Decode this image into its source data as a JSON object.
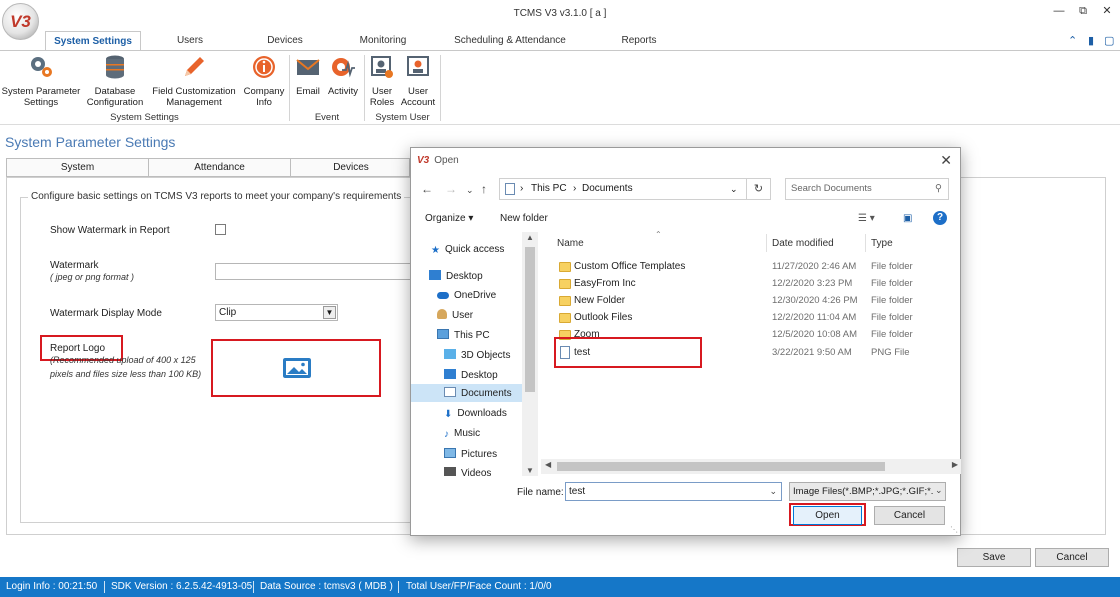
{
  "app": {
    "logo_text": "V3",
    "title": "TCMS V3 v3.1.0 [ a ]"
  },
  "ribbon": {
    "tabs": [
      {
        "label": "System Settings",
        "active": true
      },
      {
        "label": "Users"
      },
      {
        "label": "Devices"
      },
      {
        "label": "Monitoring"
      },
      {
        "label": "Scheduling & Attendance"
      },
      {
        "label": "Reports"
      }
    ],
    "buttons": [
      {
        "line1": "System Parameter",
        "line2": "Settings",
        "icon": "gears-icon"
      },
      {
        "line1": "Database",
        "line2": "Configuration",
        "icon": "database-icon"
      },
      {
        "line1": "Field Customization",
        "line2": "Management",
        "icon": "pencil-icon"
      },
      {
        "line1": "Company",
        "line2": "Info",
        "icon": "info-icon"
      },
      {
        "line1": "Email",
        "line2": "",
        "icon": "envelope-icon"
      },
      {
        "line1": "Activity",
        "line2": "",
        "icon": "activity-icon"
      },
      {
        "line1": "User",
        "line2": "Roles",
        "icon": "user-roles-icon"
      },
      {
        "line1": "User",
        "line2": "Account",
        "icon": "user-account-icon"
      }
    ],
    "groups": [
      "System Settings",
      "Event",
      "System User"
    ]
  },
  "page": {
    "title": "System Parameter Settings",
    "tabs": [
      "System",
      "Attendance",
      "Devices"
    ],
    "legend": "Configure basic settings on TCMS V3 reports to meet your company's requirements",
    "show_watermark_label": "Show Watermark in Report",
    "watermark_label": "Watermark",
    "watermark_hint": "( jpeg or png format )",
    "watermark_mode_label": "Watermark Display Mode",
    "watermark_mode_value": "Clip",
    "report_logo_label": "Report Logo",
    "report_logo_hint_1": "(Recommended upload of 400 x 125",
    "report_logo_hint_2": "pixels and files size less than 100 KB)",
    "save_label": "Save",
    "cancel_label": "Cancel"
  },
  "status": {
    "login": "Login Info : 00:21:50",
    "sdk": "SDK Version : 6.2.5.42-4913-05",
    "datasource": "Data Source : tcmsv3 ( MDB )",
    "count": "Total User/FP/Face Count : 1/0/0"
  },
  "dialog": {
    "title": "Open",
    "breadcrumb_1": "This PC",
    "breadcrumb_2": "Documents",
    "search_placeholder": "Search Documents",
    "organize": "Organize ▾",
    "new_folder": "New folder",
    "nav": [
      {
        "label": "Quick access",
        "icon": "star-icon"
      },
      {
        "label": "Desktop",
        "icon": "desktop-icon"
      },
      {
        "label": "OneDrive",
        "icon": "cloud-icon"
      },
      {
        "label": "User",
        "icon": "user-icon"
      },
      {
        "label": "This PC",
        "icon": "computer-icon"
      },
      {
        "label": "3D Objects",
        "icon": "cube-icon"
      },
      {
        "label": "Desktop",
        "icon": "desktop-icon"
      },
      {
        "label": "Documents",
        "icon": "documents-icon",
        "selected": true
      },
      {
        "label": "Downloads",
        "icon": "download-icon"
      },
      {
        "label": "Music",
        "icon": "music-icon"
      },
      {
        "label": "Pictures",
        "icon": "pictures-icon"
      },
      {
        "label": "Videos",
        "icon": "videos-icon"
      }
    ],
    "columns": [
      "Name",
      "Date modified",
      "Type"
    ],
    "files": [
      {
        "name": "Custom Office Templates",
        "date": "11/27/2020 2:46 AM",
        "type": "File folder",
        "kind": "folder"
      },
      {
        "name": "EasyFrom Inc",
        "date": "12/2/2020 3:23 PM",
        "type": "File folder",
        "kind": "folder"
      },
      {
        "name": "New Folder",
        "date": "12/30/2020 4:26 PM",
        "type": "File folder",
        "kind": "folder"
      },
      {
        "name": "Outlook Files",
        "date": "12/2/2020 11:04 AM",
        "type": "File folder",
        "kind": "folder"
      },
      {
        "name": "Zoom",
        "date": "12/5/2020 10:08 AM",
        "type": "File folder",
        "kind": "folder"
      },
      {
        "name": "test",
        "date": "3/22/2021 9:50 AM",
        "type": "PNG File",
        "kind": "file"
      }
    ],
    "file_name_label": "File name:",
    "file_name_value": "test",
    "filter": "Image Files(*.BMP;*.JPG;*.GIF;*.",
    "open_label": "Open",
    "cancel_label": "Cancel"
  }
}
